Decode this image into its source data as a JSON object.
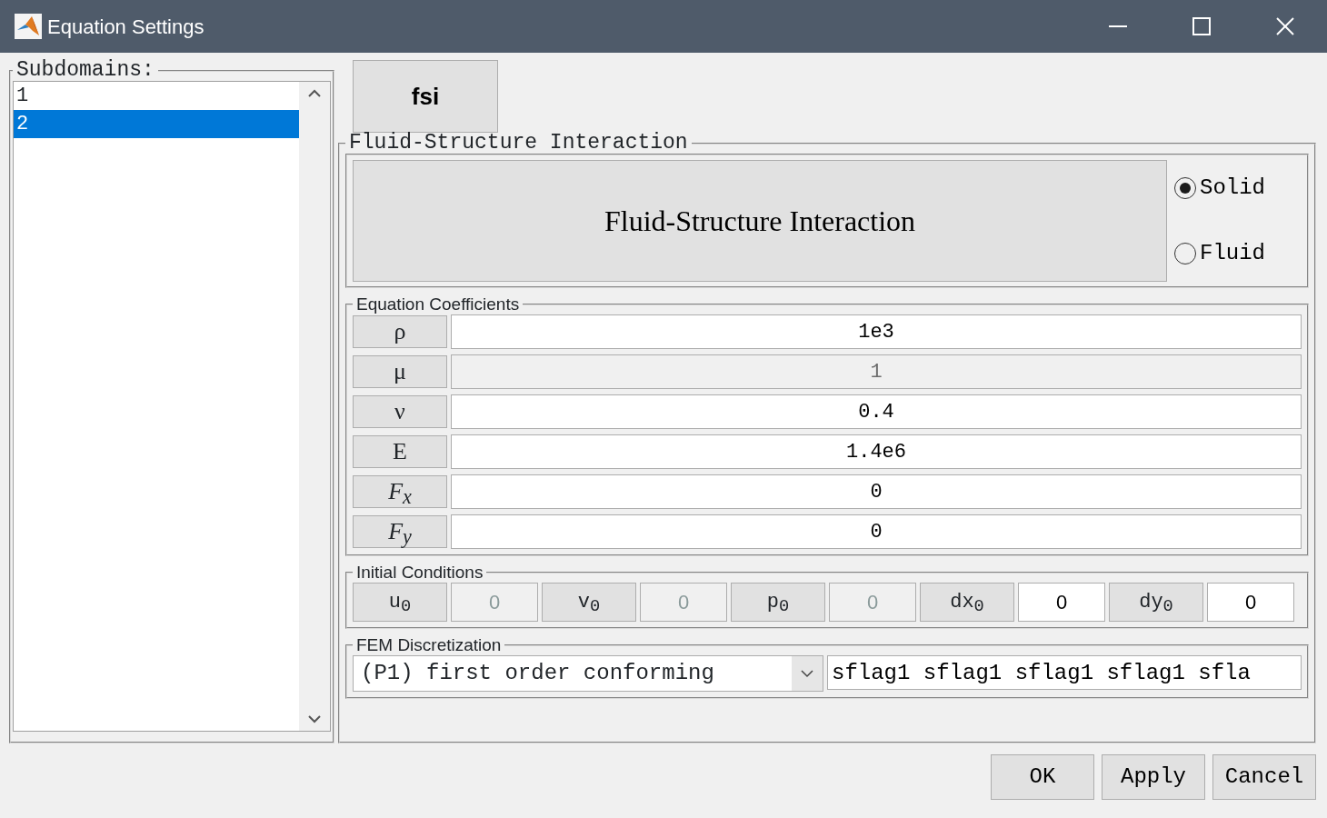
{
  "window": {
    "title": "Equation Settings"
  },
  "subdomains": {
    "label": "Subdomains:",
    "items": [
      {
        "text": "1",
        "selected": false
      },
      {
        "text": "2",
        "selected": true
      }
    ]
  },
  "tab": {
    "label": "fsi"
  },
  "panel": {
    "legend": "Fluid-Structure Interaction",
    "heading": "Fluid-Structure Interaction",
    "modes": [
      {
        "label": "Solid",
        "selected": true
      },
      {
        "label": "Fluid",
        "selected": false
      }
    ]
  },
  "coefficients": {
    "legend": "Equation Coefficients",
    "rows": [
      {
        "label": "ρ",
        "italic": false,
        "value": "1e3",
        "disabled": false
      },
      {
        "label": "μ",
        "italic": false,
        "value": "1",
        "disabled": true
      },
      {
        "label": "ν",
        "italic": false,
        "value": "0.4",
        "disabled": false
      },
      {
        "label": "E",
        "italic": false,
        "value": "1.4e6",
        "disabled": false
      },
      {
        "label": "F$_{x}$",
        "italic": true,
        "value": "0",
        "disabled": false
      },
      {
        "label": "F$_{y}$",
        "italic": true,
        "value": "0",
        "disabled": false
      }
    ]
  },
  "initial_conditions": {
    "legend": "Initial Conditions",
    "items": [
      {
        "label": "u$_{0}$",
        "value": "0",
        "disabled": true
      },
      {
        "label": "v$_{0}$",
        "value": "0",
        "disabled": true
      },
      {
        "label": "p$_{0}$",
        "value": "0",
        "disabled": true
      },
      {
        "label": "dx$_{0}$",
        "value": "0",
        "disabled": false
      },
      {
        "label": "dy$_{0}$",
        "value": "0",
        "disabled": false
      }
    ]
  },
  "fem": {
    "legend": "FEM Discretization",
    "element": "(P1) first order conforming",
    "flags": "sflag1 sflag1 sflag1 sflag1 sfla"
  },
  "buttons": [
    "OK",
    "Apply",
    "Cancel"
  ]
}
